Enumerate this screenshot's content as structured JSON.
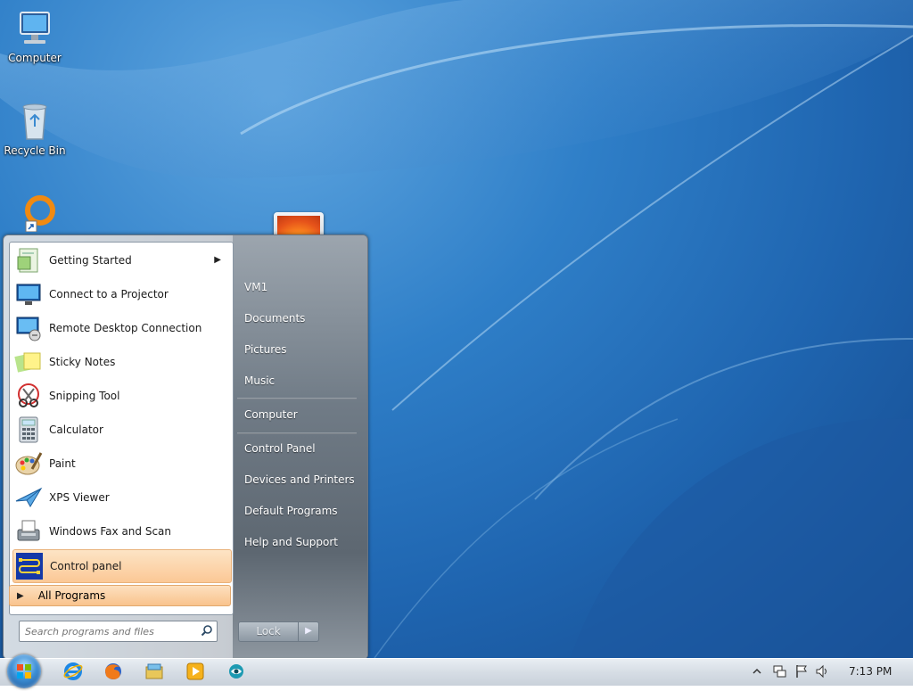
{
  "desktop": {
    "icons": [
      {
        "label": "Computer"
      },
      {
        "label": "Recycle Bin"
      }
    ]
  },
  "start_menu": {
    "programs": [
      {
        "label": "Getting Started",
        "icon": "getting-started-icon",
        "has_submenu": true
      },
      {
        "label": "Connect to a Projector",
        "icon": "projector-icon"
      },
      {
        "label": "Remote Desktop Connection",
        "icon": "remote-desktop-icon"
      },
      {
        "label": "Sticky Notes",
        "icon": "sticky-notes-icon"
      },
      {
        "label": "Snipping Tool",
        "icon": "scissors-icon"
      },
      {
        "label": "Calculator",
        "icon": "calculator-icon"
      },
      {
        "label": "Paint",
        "icon": "paint-palette-icon"
      },
      {
        "label": "XPS Viewer",
        "icon": "xps-viewer-icon"
      },
      {
        "label": "Windows Fax and Scan",
        "icon": "fax-icon"
      },
      {
        "label": "Control panel",
        "icon": "control-panel-icon",
        "highlighted": true
      }
    ],
    "all_programs_label": "All Programs",
    "search": {
      "placeholder": "Search programs and files"
    },
    "right_items": [
      {
        "label": "VM1"
      },
      {
        "label": "Documents"
      },
      {
        "label": "Pictures"
      },
      {
        "label": "Music"
      },
      {
        "label": "Computer"
      },
      {
        "label": "Control Panel"
      },
      {
        "label": "Devices and Printers"
      },
      {
        "label": "Default Programs"
      },
      {
        "label": "Help and Support"
      }
    ],
    "lock_label": "Lock"
  },
  "taskbar": {
    "apps": [
      "internet-explorer-icon",
      "firefox-icon",
      "file-explorer-icon",
      "media-player-icon",
      "network-app-icon"
    ],
    "clock": "7:13 PM"
  }
}
